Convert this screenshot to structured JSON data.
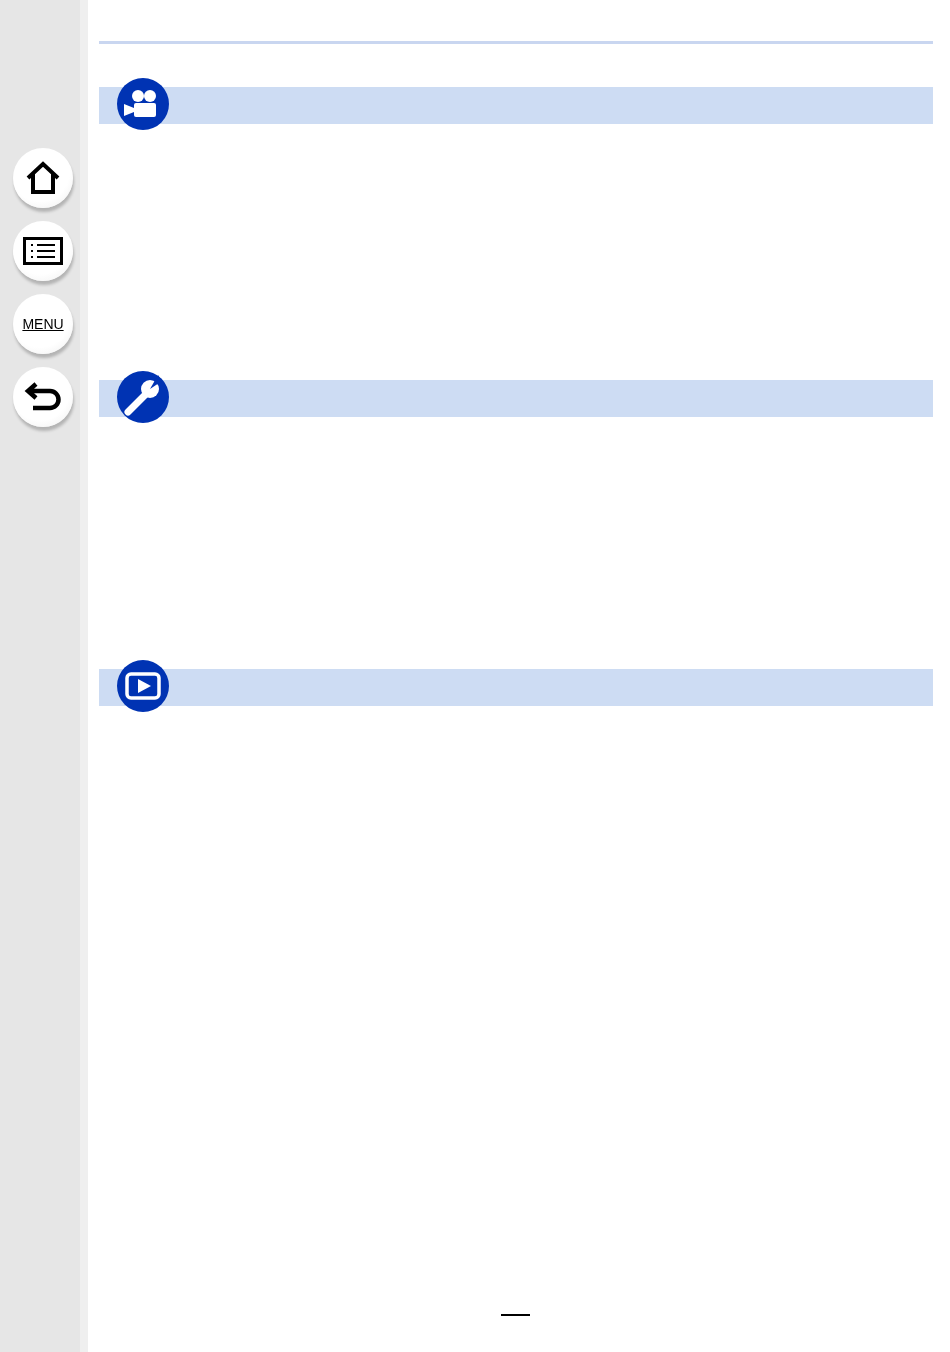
{
  "sidebar": {
    "buttons": [
      {
        "kind": "home"
      },
      {
        "kind": "contents"
      },
      {
        "kind": "menu",
        "label": "MENU"
      },
      {
        "kind": "back"
      }
    ]
  },
  "sections": [
    {
      "kind": "video"
    },
    {
      "kind": "setup"
    },
    {
      "kind": "playback"
    }
  ]
}
